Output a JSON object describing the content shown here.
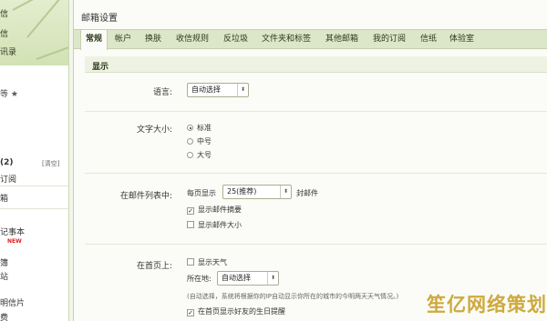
{
  "sidebar": {
    "top_labels": [
      "信",
      "信",
      "讯录"
    ],
    "rating_text": "等 ★",
    "folder_count": "(2)",
    "clear_label": "[清空]",
    "items": [
      "订阅",
      "箱",
      "记事本",
      "簿",
      "站",
      "明信片",
      "费"
    ],
    "new_badge": "NEW"
  },
  "main": {
    "title": "邮箱设置",
    "tabs": [
      {
        "label": "常规",
        "active": true
      },
      {
        "label": "帐户",
        "active": false
      },
      {
        "label": "换肤",
        "active": false
      },
      {
        "label": "收信规则",
        "active": false
      },
      {
        "label": "反垃圾",
        "active": false
      },
      {
        "label": "文件夹和标签",
        "active": false
      },
      {
        "label": "其他邮箱",
        "active": false
      },
      {
        "label": "我的订阅",
        "active": false
      },
      {
        "label": "信纸",
        "active": false
      },
      {
        "label": "体验室",
        "active": false
      }
    ],
    "section_title": "显示",
    "language": {
      "label": "语言:",
      "value": "自动选择"
    },
    "font_size": {
      "label": "文字大小:",
      "options": [
        {
          "label": "标准",
          "checked": true
        },
        {
          "label": "中号",
          "checked": false
        },
        {
          "label": "大号",
          "checked": false
        }
      ]
    },
    "mail_list": {
      "label": "在邮件列表中:",
      "per_page_prefix": "每页显示",
      "per_page_value": "25(推荐)",
      "per_page_suffix": "封邮件",
      "show_summary": {
        "label": "显示邮件摘要",
        "checked": true
      },
      "show_size": {
        "label": "显示邮件大小",
        "checked": false
      }
    },
    "homepage": {
      "label": "在首页上:",
      "show_weather": {
        "label": "显示天气",
        "checked": false
      },
      "location_label": "所在地:",
      "location_value": "自动选择",
      "location_hint": "(自动选择，系统将根据你的IP自动显示你所在的城市的今明两天天气情况。)",
      "show_birthday": {
        "label": "在首页显示好友的生日提醒",
        "checked": true
      }
    }
  },
  "watermark": "笙亿网络策划",
  "colors": {
    "tab_bar": "#dce6c9",
    "section_bar": "#eef2e3",
    "accent_star": "#f0a500",
    "watermark": "#caa12a"
  }
}
